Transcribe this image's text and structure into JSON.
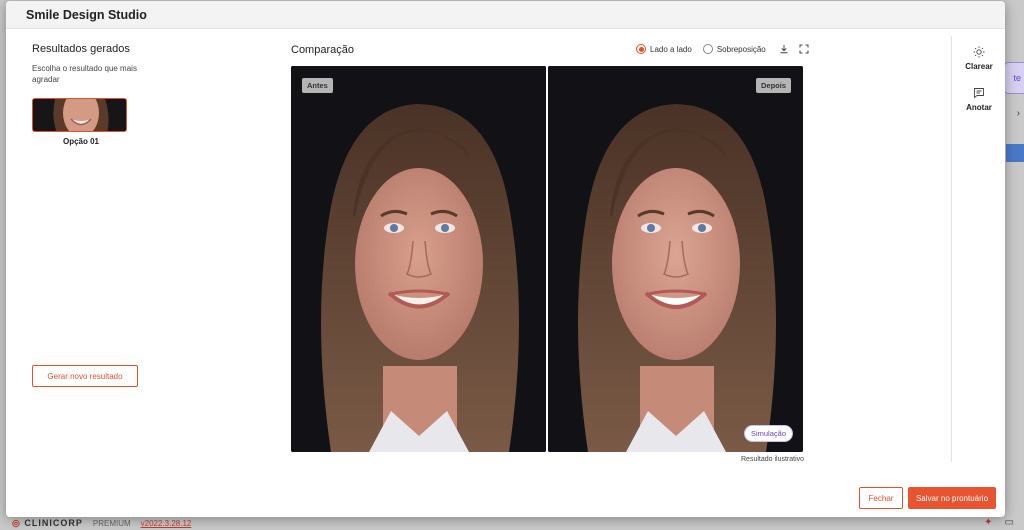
{
  "background": {
    "logo": "CLINICORP",
    "plan": "PREMIUM",
    "version": "v2022.3.28.12"
  },
  "modal": {
    "title": "Smile Design Studio"
  },
  "results": {
    "heading": "Resultados gerados",
    "hint": "Escolha o resultado que mais agradar",
    "options": [
      {
        "label": "Opção 01",
        "selected": true
      }
    ],
    "generate_label": "Gerar novo resultado"
  },
  "comparison": {
    "title": "Comparação",
    "view_options": [
      {
        "label": "Lado a lado",
        "checked": true
      },
      {
        "label": "Sobreposição",
        "checked": false
      }
    ],
    "download_icon": "download-icon",
    "fullscreen_icon": "fullscreen-icon",
    "before_label": "Antes",
    "after_label": "Depois",
    "simulation_badge": "Simulação",
    "caption": "Resultado ilustrativo"
  },
  "tools": [
    {
      "label": "Clarear",
      "icon": "sun-icon"
    },
    {
      "label": "Anotar",
      "icon": "comment-icon"
    }
  ],
  "footer": {
    "close_label": "Fechar",
    "save_label": "Salvar no prontuário"
  },
  "colors": {
    "accent": "#e8542f",
    "simulation": "#6d3fd2"
  }
}
